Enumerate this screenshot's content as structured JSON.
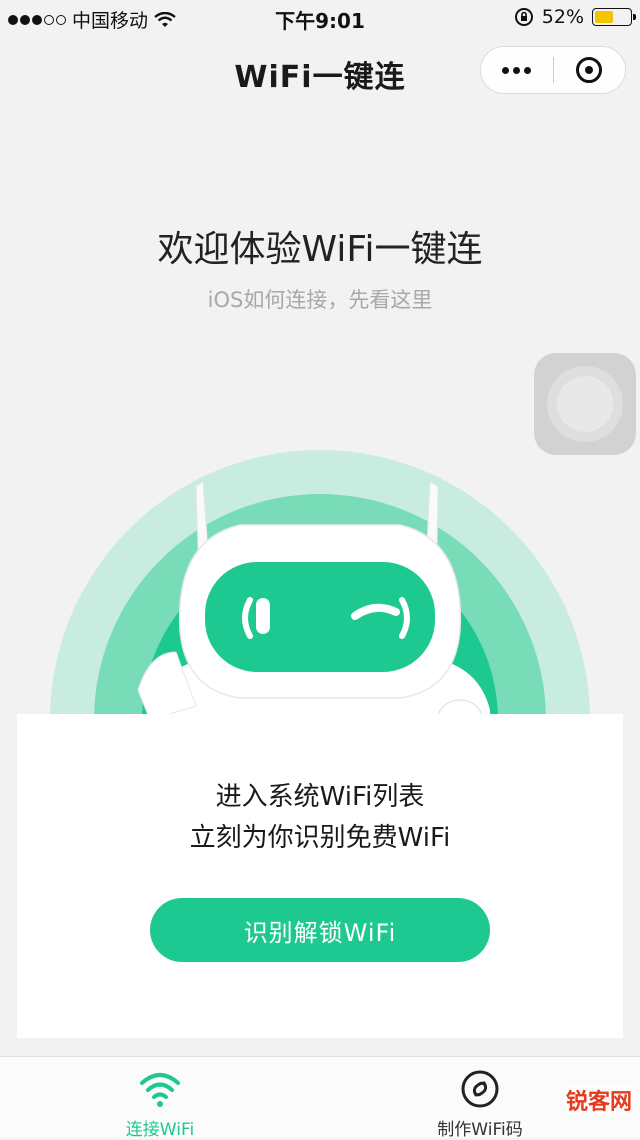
{
  "status_bar": {
    "carrier": "中国移动",
    "time": "下午9:01",
    "battery_percent": "52%",
    "battery_level": 0.52,
    "icons": [
      "signal-dots",
      "wifi-icon",
      "orientation-lock-icon",
      "battery-icon"
    ]
  },
  "nav": {
    "title": "WiFi一键连",
    "capsule": {
      "more_icon": "more-dots-icon",
      "close_icon": "target-icon"
    }
  },
  "welcome": {
    "title": "欢迎体验WiFi一键连",
    "subtitle": "iOS如何连接，先看这里"
  },
  "card": {
    "line1": "进入系统WiFi列表",
    "line2": "立刻为你识别免费WiFi",
    "button_label": "识别解锁WiFi"
  },
  "tab_bar": {
    "tabs": [
      {
        "label": "连接WiFi",
        "icon": "wifi-icon",
        "active": true
      },
      {
        "label": "制作WiFi码",
        "icon": "wifi-code-icon",
        "active": false
      }
    ]
  },
  "watermark": "锐客网",
  "colors": {
    "accent": "#1ec991",
    "background": "#f2f2f2",
    "card": "#ffffff",
    "battery": "#f5c400"
  }
}
